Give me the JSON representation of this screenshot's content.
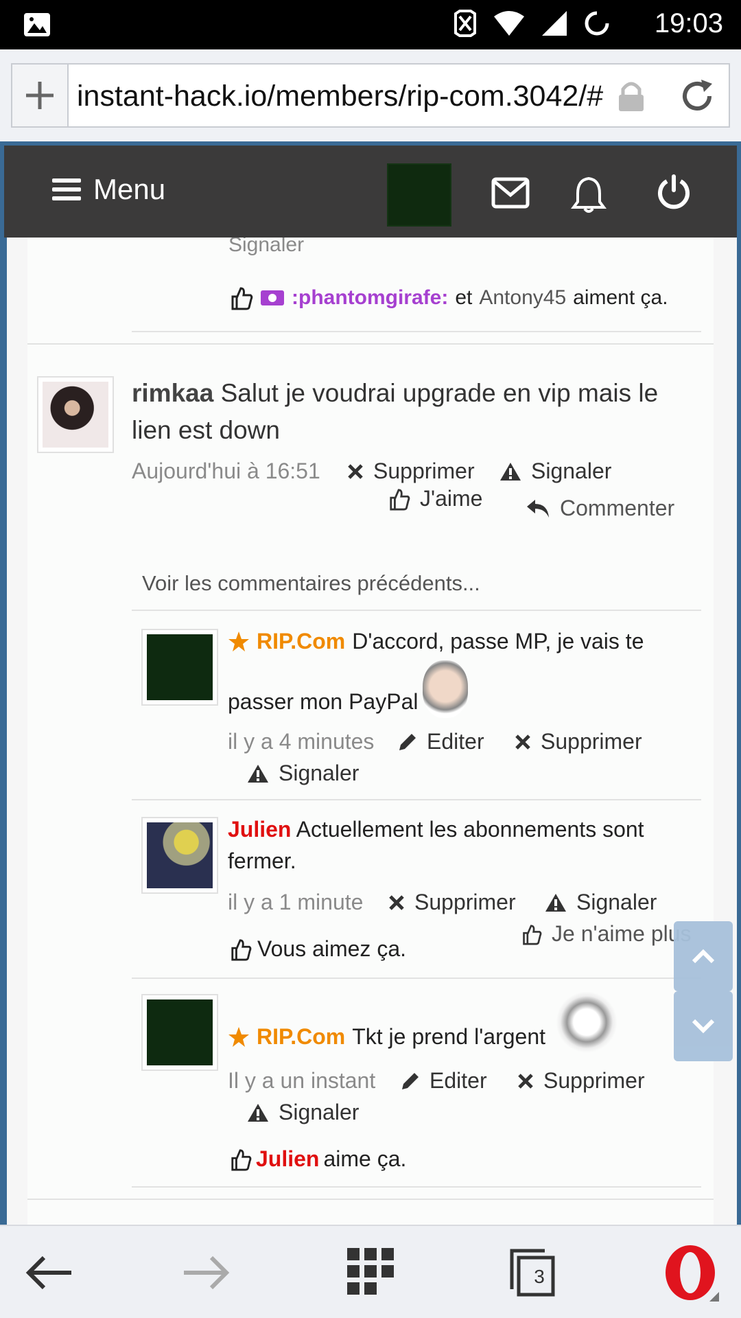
{
  "status": {
    "time": "19:03"
  },
  "browser": {
    "url": "instant-hack.io/members/rip-com.3042/#"
  },
  "header": {
    "menu_label": "Menu"
  },
  "prev_post": {
    "signaler": "Signaler",
    "likes_user1": ":phantomgirafe:",
    "likes_and": "et",
    "likes_user2": "Antony45",
    "likes_suffix": "aiment ça."
  },
  "post": {
    "author": "rimkaa",
    "text_line1": "Salut je voudrai upgrade en vip mais le",
    "text_line2": "lien est down",
    "time": "Aujourd'hui à 16:51",
    "delete": "Supprimer",
    "report": "Signaler",
    "like": "J'aime",
    "comment": "Commenter",
    "view_previous": "Voir les commentaires précédents..."
  },
  "comments": [
    {
      "author": "RIP.Com",
      "text_line1": "D'accord, passe MP, je vais te",
      "text_line2": "passer mon PayPal",
      "time": "il y a 4 minutes",
      "edit": "Editer",
      "delete": "Supprimer",
      "report": "Signaler"
    },
    {
      "author": "Julien",
      "text_line1": "Actuellement les abonnements sont",
      "text_line2": "fermer.",
      "time": "il y a 1 minute",
      "delete": "Supprimer",
      "report": "Signaler",
      "unlike": "Je n'aime plus",
      "likes": "Vous aimez ça."
    },
    {
      "author": "RIP.Com",
      "text": "Tkt je prend l'argent",
      "time": "Il y a un instant",
      "edit": "Editer",
      "delete": "Supprimer",
      "report": "Signaler",
      "likes_user": "Julien",
      "likes_suffix": "aime ça."
    }
  ],
  "tabs": {
    "count": "3"
  },
  "colors": {
    "accent_orange": "#f08a00",
    "julien_red": "#e01010",
    "purple": "#a640d0"
  }
}
